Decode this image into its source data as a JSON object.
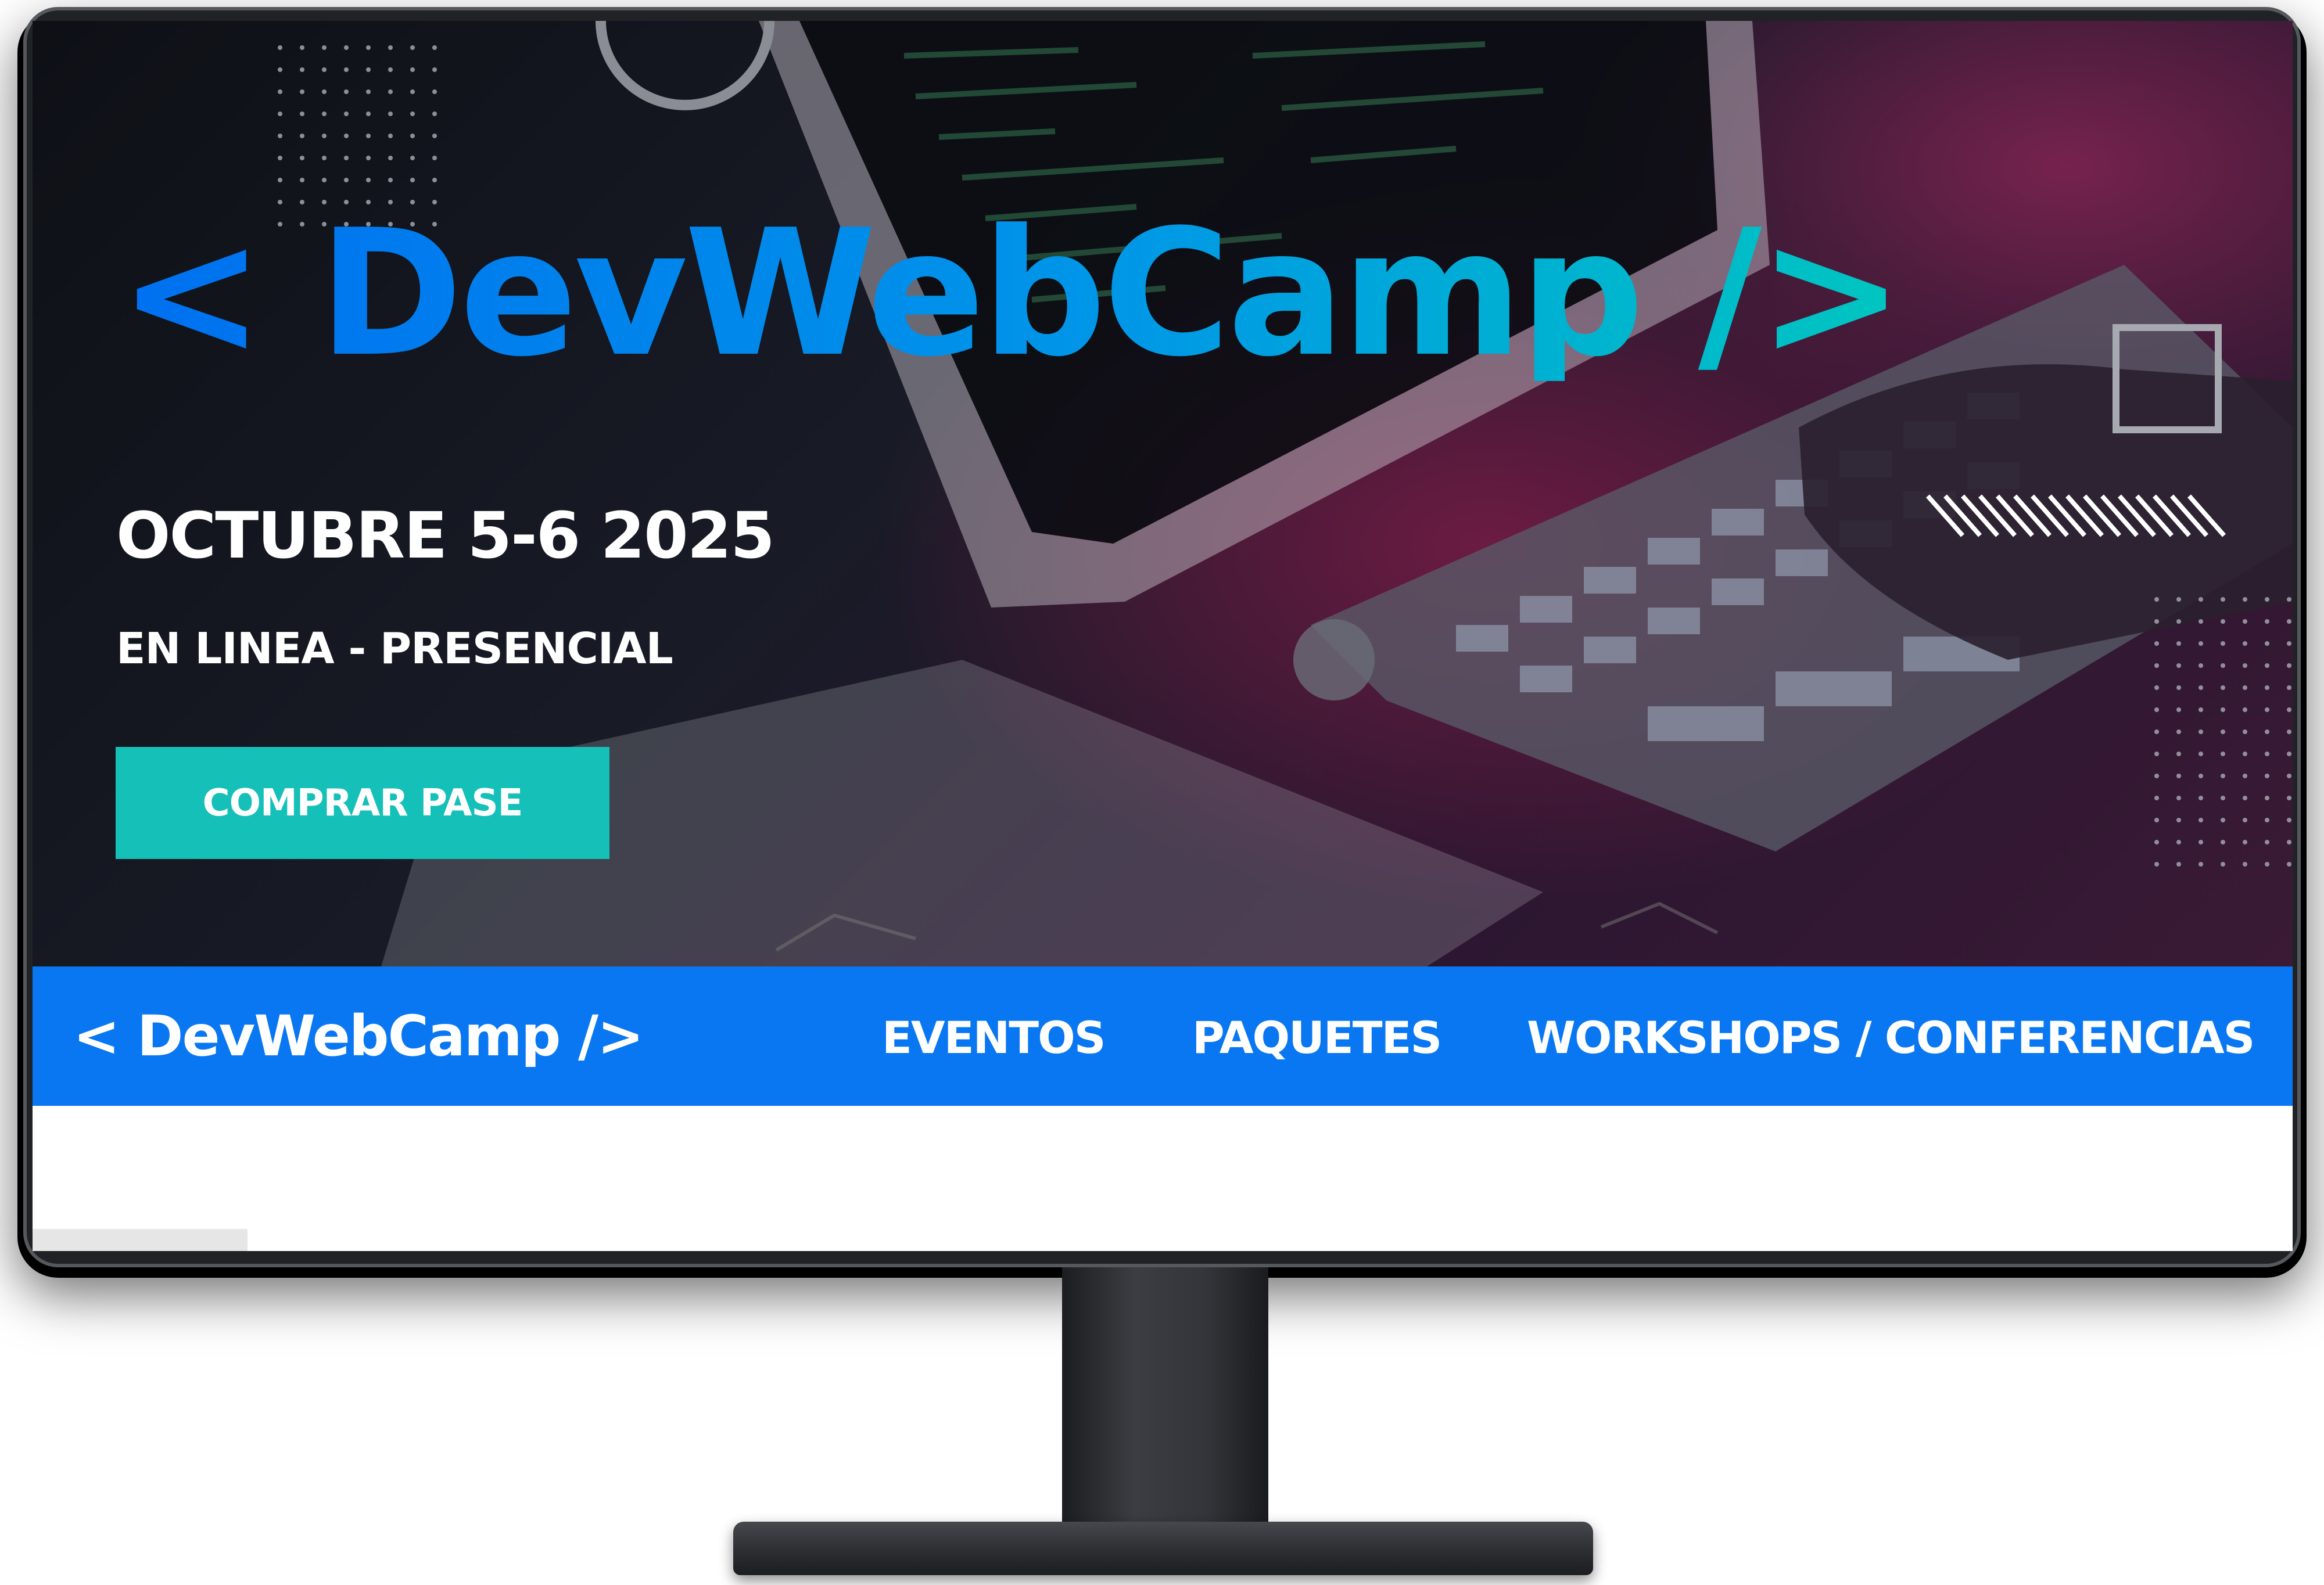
{
  "hero": {
    "title": "< DevWebCamp />",
    "date": "OCTUBRE 5-6 2025",
    "mode": "EN LINEA - PRESENCIAL",
    "cta_label": "COMPRAR PASE"
  },
  "navbar": {
    "logo": "< DevWebCamp />",
    "links": [
      "EVENTOS",
      "PAQUETES",
      "WORKSHOPS / CONFERENCIAS"
    ]
  },
  "colors": {
    "brand_blue": "#0a77f2",
    "cta_teal": "#15c0b8",
    "title_gradient_start": "#0070f0",
    "title_gradient_end": "#00c6c0"
  }
}
